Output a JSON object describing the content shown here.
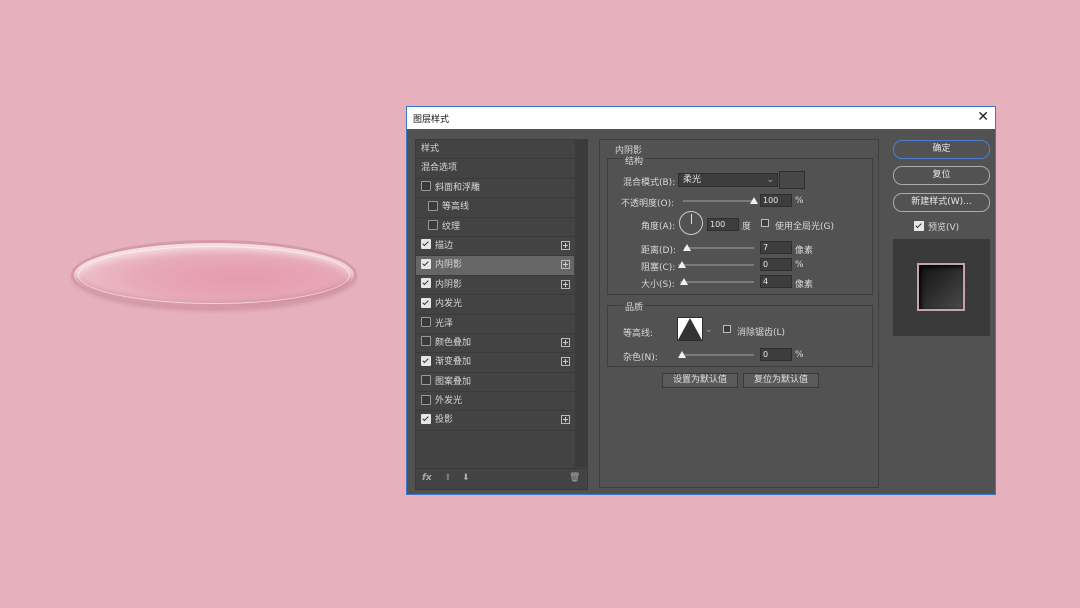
{
  "dialog": {
    "title": "图层样式",
    "close_label": "✕"
  },
  "styles": {
    "items": [
      {
        "label": "样式",
        "checkbox": false,
        "checked": false,
        "plus": false,
        "indent": false,
        "selected": false
      },
      {
        "label": "混合选项",
        "checkbox": false,
        "checked": false,
        "plus": false,
        "indent": false,
        "selected": false
      },
      {
        "label": "斜面和浮雕",
        "checkbox": true,
        "checked": false,
        "plus": false,
        "indent": false,
        "selected": false
      },
      {
        "label": "等高线",
        "checkbox": true,
        "checked": false,
        "plus": false,
        "indent": true,
        "selected": false
      },
      {
        "label": "纹理",
        "checkbox": true,
        "checked": false,
        "plus": false,
        "indent": true,
        "selected": false
      },
      {
        "label": "描边",
        "checkbox": true,
        "checked": true,
        "plus": true,
        "indent": false,
        "selected": false
      },
      {
        "label": "内阴影",
        "checkbox": true,
        "checked": true,
        "plus": true,
        "indent": false,
        "selected": true
      },
      {
        "label": "内阴影",
        "checkbox": true,
        "checked": true,
        "plus": true,
        "indent": false,
        "selected": false
      },
      {
        "label": "内发光",
        "checkbox": true,
        "checked": true,
        "plus": false,
        "indent": false,
        "selected": false
      },
      {
        "label": "光泽",
        "checkbox": true,
        "checked": false,
        "plus": false,
        "indent": false,
        "selected": false
      },
      {
        "label": "颜色叠加",
        "checkbox": true,
        "checked": false,
        "plus": true,
        "indent": false,
        "selected": false
      },
      {
        "label": "渐变叠加",
        "checkbox": true,
        "checked": true,
        "plus": true,
        "indent": false,
        "selected": false
      },
      {
        "label": "图案叠加",
        "checkbox": true,
        "checked": false,
        "plus": false,
        "indent": false,
        "selected": false
      },
      {
        "label": "外发光",
        "checkbox": true,
        "checked": false,
        "plus": false,
        "indent": false,
        "selected": false
      },
      {
        "label": "投影",
        "checkbox": true,
        "checked": true,
        "plus": true,
        "indent": false,
        "selected": false
      }
    ],
    "bottom": {
      "fx": "fx",
      "up": "⬆",
      "down": "⬇",
      "trash": "🗑"
    }
  },
  "inner_shadow": {
    "section_title": "内阴影",
    "structure_title": "结构",
    "blend_mode_label": "混合模式(B):",
    "blend_mode_value": "柔光",
    "opacity_label": "不透明度(O):",
    "opacity_value": "100",
    "opacity_unit": "%",
    "angle_label": "角度(A):",
    "angle_value": "100",
    "angle_unit": "度",
    "global_light_label": "使用全局光(G)",
    "distance_label": "距离(D):",
    "distance_value": "7",
    "distance_unit": "像素",
    "choke_label": "阻塞(C):",
    "choke_value": "0",
    "choke_unit": "%",
    "size_label": "大小(S):",
    "size_value": "4",
    "size_unit": "像素",
    "quality_title": "品质",
    "contour_label": "等高线:",
    "antialias_label": "消除锯齿(L)",
    "noise_label": "杂色(N):",
    "noise_value": "0",
    "noise_unit": "%",
    "set_default_label": "设置为默认值",
    "reset_default_label": "复位为默认值"
  },
  "actions": {
    "ok_label": "确定",
    "reset_label": "复位",
    "new_style_label": "新建样式(W)...",
    "preview_label": "预览(V)"
  },
  "colors": {
    "background": "#e6b1bd",
    "dialog_bg": "#525252",
    "accent_border": "#3c78c8"
  }
}
